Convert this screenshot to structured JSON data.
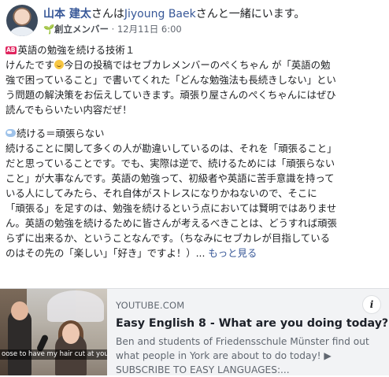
{
  "header": {
    "author": "山本 建太",
    "with_text": "さんは",
    "tagged": "Jiyoung Baek",
    "suffix_text": "さんと一緒にいます。",
    "badge": "創立メンバー",
    "separator": " · ",
    "date": "12月11日 6:00",
    "sprout_icon": "🌱"
  },
  "post": {
    "ab_label": "AB",
    "lines": [
      "英語の勉強を続ける技術１",
      "けんたです",
      "今日の投稿ではセブカレメンバーのぺくちゃん が「英語の勉",
      "強で困っていること」で書いてくれた「どんな勉強法も長続きしない」とい",
      "う問題の解決策をお伝えしていきます。頑張り屋さんのぺくちゃんにはぜひ",
      "読んでもらいたい内容だぜ！",
      "続ける＝頑張らない",
      "続けることに関して多くの人が勘違いしているのは、それを「頑張ること」",
      "だと思っていることです。でも、実際は逆で、続けるためには「頑張らない",
      "こと」が大事なんです。英語の勉強って、初級者や英語に苦手意識を持って",
      "いる人にしてみたら、それ自体がストレスになりかねないので、そこに",
      "「頑張る」を足すのは、勉強を続けるという点においては賢明ではありませ",
      "ん。英語の勉強を続けるために皆さんが考えるべきことは、どうすれば頑張",
      "らずに出来るか、ということなんです。（ちなみにセブカレが目指している",
      "のはその先の「楽しい」「好き」ですよ！）... "
    ],
    "more_link": "もっと見る"
  },
  "preview": {
    "domain": "YOUTUBE.COM",
    "title": "Easy English 8 - What are you doing today?",
    "desc_lines": [
      "Ben and students of Friedensschule Münster find out",
      "what people in York are about to do today! ▶",
      "SUBSCRIBE TO EASY LANGUAGES:..."
    ],
    "thumb_caption": "oose to have my hair cut at your place and",
    "info_icon": "i"
  }
}
